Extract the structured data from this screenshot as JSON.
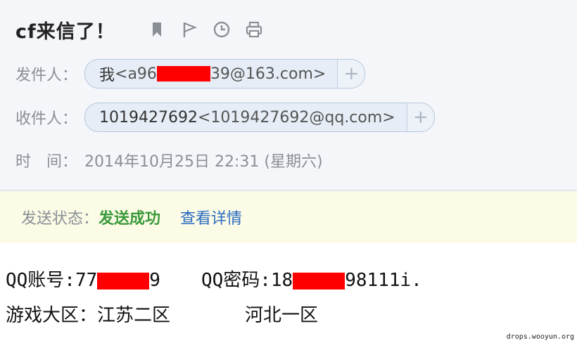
{
  "subject": "cf来信了！",
  "toolbar": {
    "icons": [
      "bookmark-icon",
      "flag-icon",
      "clock-icon",
      "print-icon"
    ]
  },
  "sender": {
    "label": "发件人：",
    "name": "我",
    "email_prefix": "<a96",
    "email_suffix": "39@163.com>",
    "add_symbol": "+"
  },
  "recipient": {
    "label": "收件人：",
    "name": "1019427692",
    "email": "<1019427692@qq.com>",
    "add_symbol": "+"
  },
  "time": {
    "label": "时　间：",
    "value": "2014年10月25日 22:31 (星期六)"
  },
  "status": {
    "label": "发送状态：",
    "value": "发送成功",
    "link": "查看详情"
  },
  "body": {
    "qq_account_label": "QQ账号:",
    "qq_account_prefix": "77",
    "qq_account_suffix": "9",
    "qq_password_label": "QQ密码:",
    "qq_password_prefix": "18",
    "qq_password_suffix": "98111i.",
    "region_label": "游戏大区：",
    "region_1": "江苏二区",
    "region_2": "河北一区"
  },
  "watermark": "drops.wooyun.org",
  "colors": {
    "redaction": "#ff0000",
    "status_success": "#3b9a3b",
    "link": "#2a6bbf",
    "chip_bg": "#e6edf6"
  }
}
